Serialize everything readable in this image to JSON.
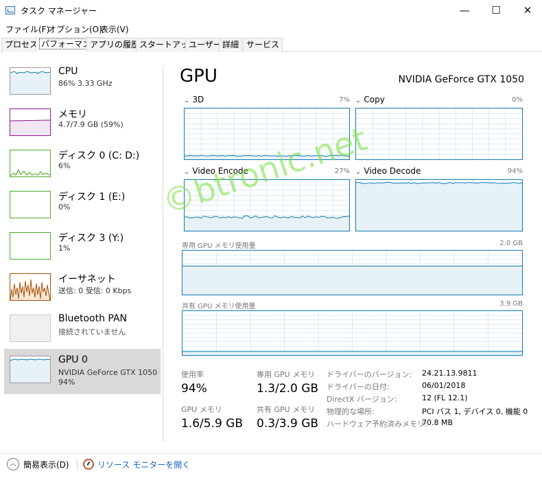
{
  "window": {
    "title": "タスク マネージャー",
    "minimize": "—",
    "maximize": "☐",
    "close": "✕"
  },
  "menu": [
    "ファイル(F)",
    "オプション(O)",
    "表示(V)"
  ],
  "tabs": [
    "プロセス",
    "パフォーマンス",
    "アプリの履歴",
    "スタートアップ",
    "ユーザー",
    "詳細",
    "サービス"
  ],
  "active_tab": "パフォーマンス",
  "sidebar": [
    {
      "name": "CPU",
      "line1": "86%  3.33 GHz",
      "line2": "",
      "color": "#1079b2"
    },
    {
      "name": "メモリ",
      "line1": "4.7/7.9 GB (59%)",
      "line2": "",
      "color": "#8b1a8b"
    },
    {
      "name": "ディスク 0 (C: D:)",
      "line1": "6%",
      "line2": "",
      "color": "#4ea72a"
    },
    {
      "name": "ディスク 1 (E:)",
      "line1": "0%",
      "line2": "",
      "color": "#4ea72a"
    },
    {
      "name": "ディスク 3 (Y:)",
      "line1": "1%",
      "line2": "",
      "color": "#4ea72a"
    },
    {
      "name": "イーサネット",
      "line1": "送信: 0  受信: 0 Kbps",
      "line2": "",
      "color": "#a74f00"
    },
    {
      "name": "Bluetooth PAN",
      "line1": "接続されていません",
      "line2": "",
      "color": "#999999"
    },
    {
      "name": "GPU 0",
      "line1": "NVIDIA GeForce GTX 1050",
      "line2": "94%",
      "color": "#1079b2"
    }
  ],
  "main": {
    "title": "GPU",
    "model": "NVIDIA GeForce GTX 1050",
    "engines": [
      {
        "label": "3D",
        "pct": "7%",
        "level": 0.07
      },
      {
        "label": "Copy",
        "pct": "0%",
        "level": 0.0
      },
      {
        "label": "Video Encode",
        "pct": "27%",
        "level": 0.27
      },
      {
        "label": "Video Decode",
        "pct": "94%",
        "level": 0.94
      }
    ],
    "dedicated": {
      "label": "専用 GPU メモリ使用量",
      "max": "2.0 GB",
      "level": 0.65
    },
    "shared": {
      "label": "共有 GPU メモリ使用量",
      "max": "3.9 GB",
      "level": 0.08
    },
    "stats": [
      {
        "label": "使用率",
        "value": "94%"
      },
      {
        "label": "専用 GPU メモリ",
        "value": "1.3/2.0 GB"
      },
      {
        "label": "GPU メモリ",
        "value": "1.6/5.9 GB"
      },
      {
        "label": "共有 GPU メモリ",
        "value": "0.3/3.9 GB"
      }
    ],
    "info": [
      {
        "label": "ドライバーのバージョン:",
        "value": "24.21.13.9811"
      },
      {
        "label": "ドライバーの日付:",
        "value": "06/01/2018"
      },
      {
        "label": "DirectX バージョン:",
        "value": "12 (FL 12.1)"
      },
      {
        "label": "物理的な場所:",
        "value": "PCI バス 1, デバイス 0, 機能 0"
      },
      {
        "label": "ハードウェア予約済みメモリ:",
        "value": "70.8 MB"
      }
    ]
  },
  "watermark": "©btronic.net",
  "footer": {
    "fewer_details": "簡易表示(D)",
    "resource_monitor": "リソース モニターを開く"
  },
  "colors": {
    "accent": "#1079b2",
    "selected_bg": "#d9d9d9"
  }
}
